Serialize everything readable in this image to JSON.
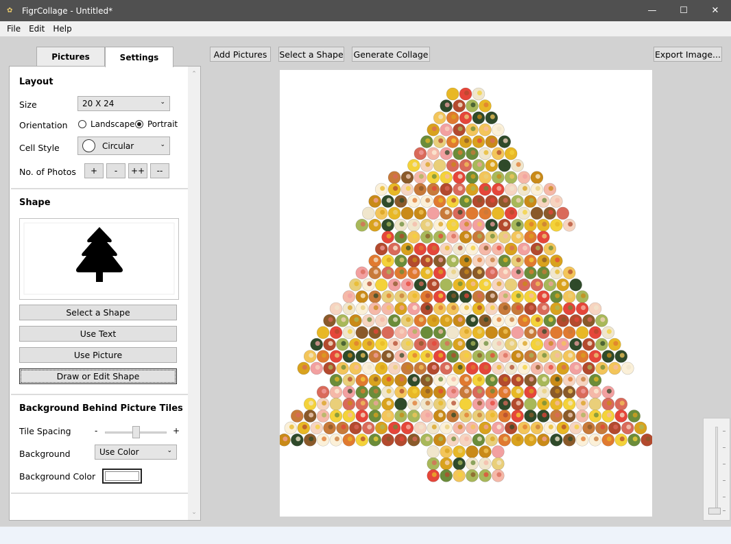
{
  "window": {
    "title": "FigrCollage - Untitled*",
    "minimize_glyph": "—",
    "maximize_glyph": "☐",
    "close_glyph": "✕"
  },
  "menu": [
    "File",
    "Edit",
    "Help"
  ],
  "tabs": [
    {
      "label": "Pictures",
      "active": false
    },
    {
      "label": "Settings",
      "active": true
    }
  ],
  "layout": {
    "title": "Layout",
    "size_label": "Size",
    "size_value": "20 X 24",
    "orientation_label": "Orientation",
    "orientation_options": [
      "Landscape",
      "Portrait"
    ],
    "orientation_selected": "Portrait",
    "cell_style_label": "Cell Style",
    "cell_style_value": "Circular",
    "photos_label": "No. of Photos",
    "photo_buttons": [
      "+",
      "-",
      "++",
      "--"
    ]
  },
  "shape": {
    "title": "Shape",
    "preview_icon": "tree-icon",
    "buttons": [
      "Select a Shape",
      "Use Text",
      "Use Picture",
      "Draw or Edit Shape"
    ]
  },
  "background": {
    "title": "Background Behind Picture Tiles",
    "spacing_label": "Tile Spacing",
    "spacing_min": "-",
    "spacing_max": "+",
    "spacing_value": 0.5,
    "background_label": "Background",
    "background_value": "Use Color",
    "color_label": "Background Color",
    "color_value": "#ffffff"
  },
  "toolbar": {
    "add_pictures": "Add Pictures",
    "select_shape": "Select a Shape",
    "generate": "Generate Collage",
    "export": "Export Image..."
  },
  "zoom": {
    "level": 0.0
  },
  "collage": {
    "shape": "christmas-tree",
    "tile_colors": [
      "#e8b826",
      "#d9a21e",
      "#f4d23a",
      "#c98a18",
      "#e5463a",
      "#f2a0a0",
      "#f6d4c0",
      "#2f4a2a",
      "#6b8c3a",
      "#c87a3a",
      "#f0e6cc",
      "#b34a2e",
      "#e9cf7a",
      "#8a5a2a",
      "#f3c55a",
      "#d96a5a",
      "#fbf0d8",
      "#a8b85a",
      "#e07a30",
      "#f5b8a8"
    ]
  }
}
